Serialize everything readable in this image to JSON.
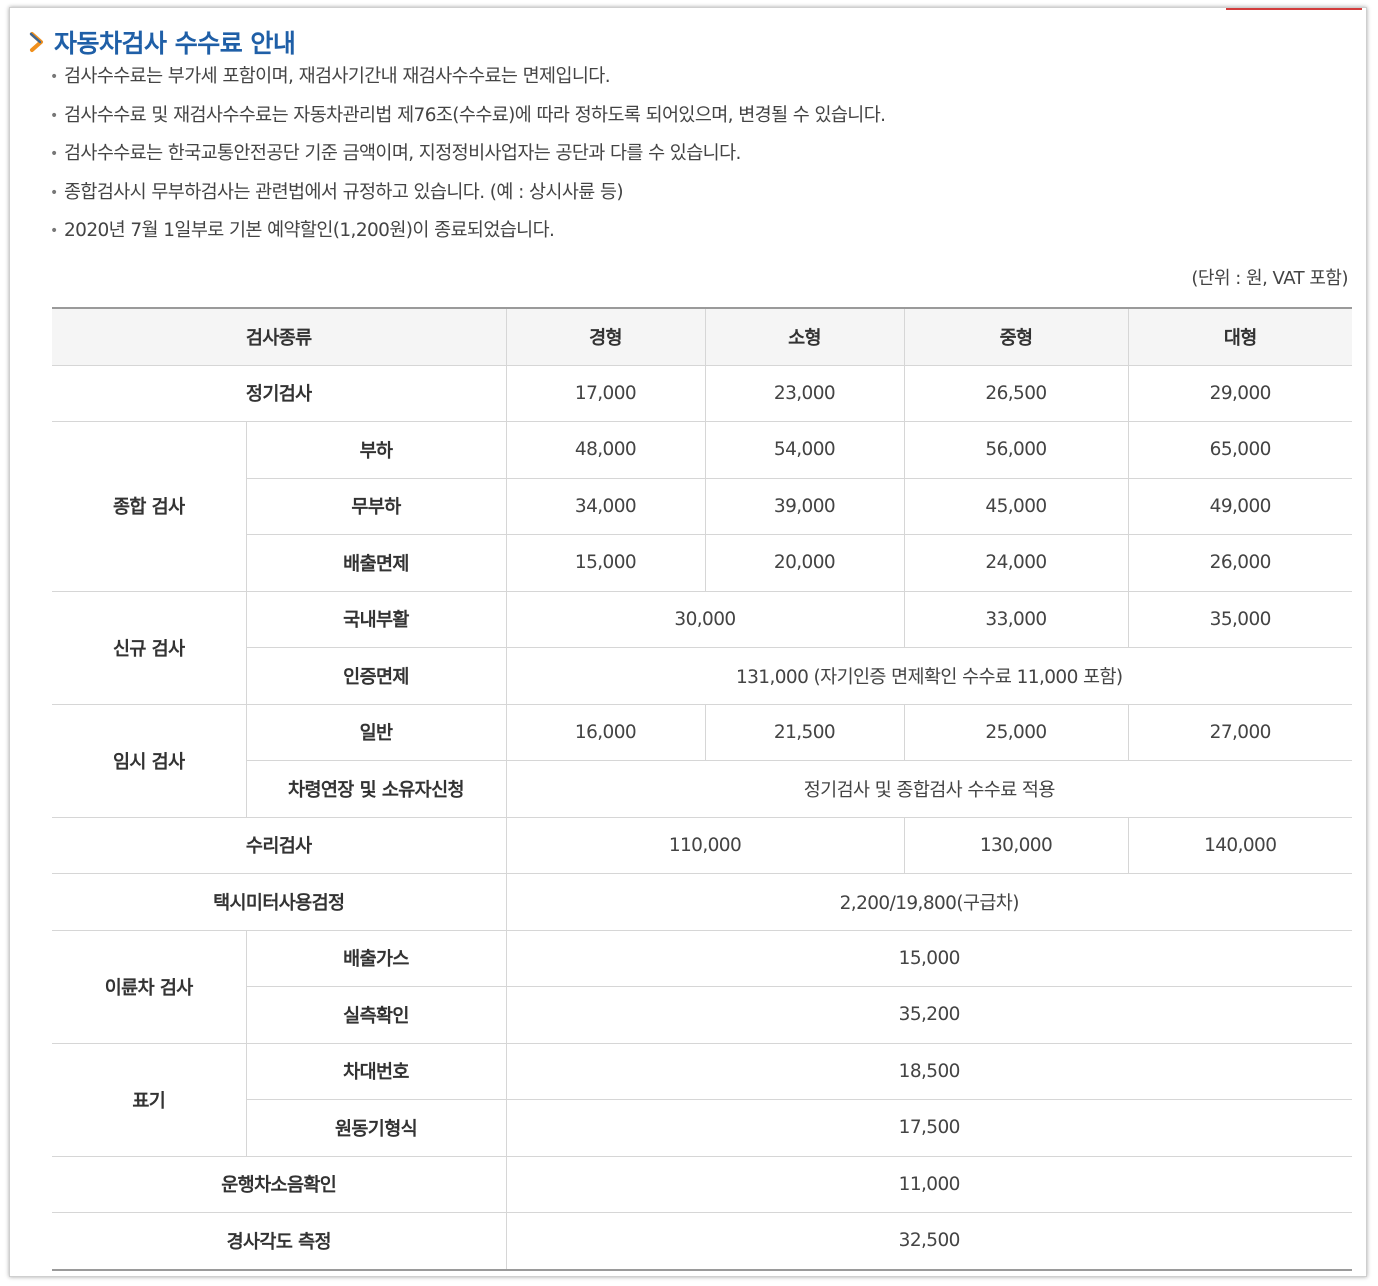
{
  "title": "자동차검사 수수료 안내",
  "notes": [
    "검사수수료는 부가세 포함이며, 재검사기간내 재검사수수료는 면제입니다.",
    "검사수수료 및 재검사수수료는 자동차관리법 제76조(수수료)에 따라 정하도록 되어있으며, 변경될 수 있습니다.",
    "검사수수료는 한국교통안전공단 기준 금액이며, 지정정비사업자는 공단과 다를 수 있습니다.",
    "종합검사시 무부하검사는 관련법에서 규정하고 있습니다. (예 : 상시사륜 등)",
    "2020년 7월 1일부로 기본 예약할인(1,200원)이 종료되었습니다."
  ],
  "unit": "(단위 : 원, VAT 포함)",
  "table": {
    "headers": [
      "검사종류",
      "경형",
      "소형",
      "중형",
      "대형"
    ],
    "periodic": {
      "label": "정기검사",
      "values": [
        "17,000",
        "23,000",
        "26,500",
        "29,000"
      ]
    },
    "comprehensive": {
      "label": "종합 검사",
      "rows": [
        {
          "label": "부하",
          "values": [
            "48,000",
            "54,000",
            "56,000",
            "65,000"
          ]
        },
        {
          "label": "무부하",
          "values": [
            "34,000",
            "39,000",
            "45,000",
            "49,000"
          ]
        },
        {
          "label": "배출면제",
          "values": [
            "15,000",
            "20,000",
            "24,000",
            "26,000"
          ]
        }
      ]
    },
    "new": {
      "label": "신규 검사",
      "domestic": {
        "label": "국내부활",
        "small": "30,000",
        "mid": "33,000",
        "large": "35,000"
      },
      "cert": {
        "label": "인증면제",
        "value": "131,000 (자기인증 면제확인 수수료 11,000 포함)"
      }
    },
    "temporary": {
      "label": "임시 검사",
      "general": {
        "label": "일반",
        "values": [
          "16,000",
          "21,500",
          "25,000",
          "27,000"
        ]
      },
      "extension": {
        "label": "차령연장 및 소유자신청",
        "value": "정기검사 및 종합검사 수수료 적용"
      }
    },
    "repair": {
      "label": "수리검사",
      "small": "110,000",
      "mid": "130,000",
      "large": "140,000"
    },
    "taxi": {
      "label": "택시미터사용검정",
      "value": "2,200/19,800(구급차)"
    },
    "two_wheel": {
      "label": "이륜차 검사",
      "rows": [
        {
          "label": "배출가스",
          "value": "15,000"
        },
        {
          "label": "실측확인",
          "value": "35,200"
        }
      ]
    },
    "marking": {
      "label": "표기",
      "rows": [
        {
          "label": "차대번호",
          "value": "18,500"
        },
        {
          "label": "원동기형식",
          "value": "17,500"
        }
      ]
    },
    "noise": {
      "label": "운행차소음확인",
      "value": "11,000"
    },
    "tilt": {
      "label": "경사각도 측정",
      "value": "32,500"
    }
  },
  "colors": {
    "title": "#1f5fa7",
    "arrow": "#f0901e",
    "accent": "#d23c3c"
  }
}
